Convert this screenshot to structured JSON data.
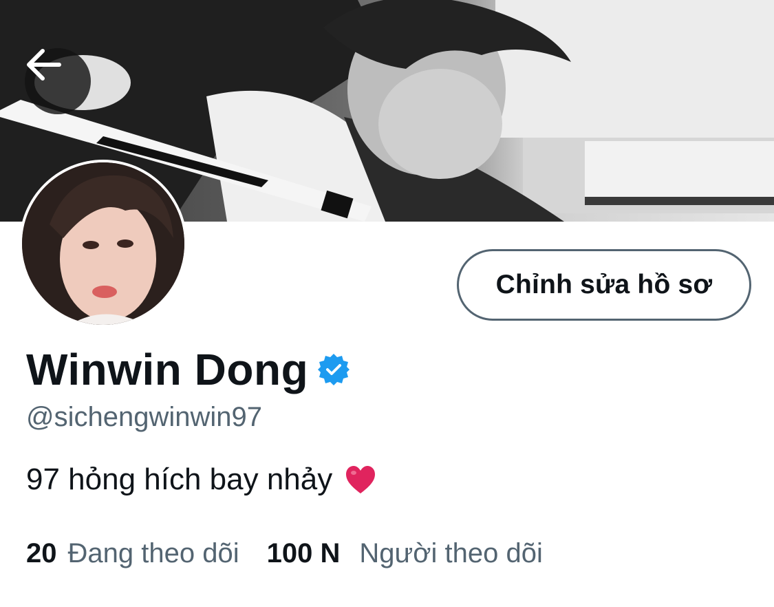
{
  "banner": {
    "image_description_icon": "banner-photo"
  },
  "header": {
    "back_icon": "back-arrow-icon"
  },
  "profile": {
    "edit_button_label": "Chỉnh sửa hồ sơ",
    "display_name": "Winwin Dong",
    "verified_icon": "verified-badge-icon",
    "handle": "@sichengwinwin97",
    "bio": "97 hỏng hích bay nhảy",
    "bio_emoji": "heart-icon"
  },
  "stats": {
    "following_count": "20",
    "following_label": "Đang theo dõi",
    "followers_count": "100 N",
    "followers_label": "Người theo dõi"
  },
  "colors": {
    "text_primary": "#0f1419",
    "text_secondary": "#536471",
    "verified_blue": "#1d9bf0",
    "heart_red": "#e0245e"
  }
}
